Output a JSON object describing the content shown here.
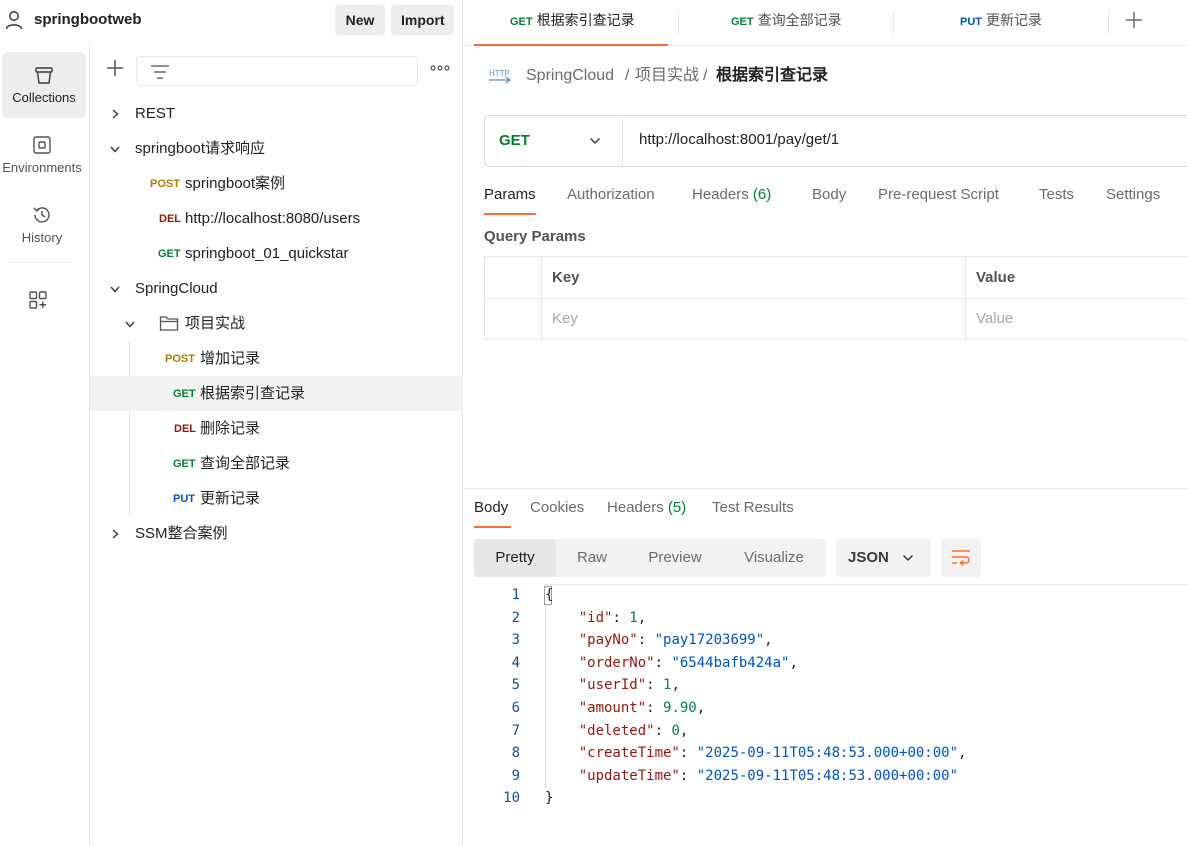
{
  "workspace": {
    "name": "springbootweb",
    "new_label": "New",
    "import_label": "Import"
  },
  "side_nav": {
    "collections": "Collections",
    "environments": "Environments",
    "history": "History"
  },
  "tree": [
    {
      "label": "REST"
    },
    {
      "label": "springboot请求响应"
    },
    {
      "method": "POST",
      "label": "springboot案例"
    },
    {
      "method": "DEL",
      "label": "http://localhost:8080/users"
    },
    {
      "method": "GET",
      "label": "springboot_01_quickstar"
    },
    {
      "label": "SpringCloud"
    },
    {
      "label": "项目实战"
    },
    {
      "method": "POST",
      "label": "增加记录"
    },
    {
      "method": "GET",
      "label": "根据索引查记录"
    },
    {
      "method": "DEL",
      "label": "删除记录"
    },
    {
      "method": "GET",
      "label": "查询全部记录"
    },
    {
      "method": "PUT",
      "label": "更新记录"
    },
    {
      "label": "SSM整合案例"
    }
  ],
  "tabs": [
    {
      "method": "GET",
      "label": "根据索引查记录"
    },
    {
      "method": "GET",
      "label": "查询全部记录"
    },
    {
      "method": "PUT",
      "label": "更新记录"
    }
  ],
  "breadcrumb": {
    "icon_text": "HTTP",
    "items": [
      "SpringCloud",
      "/",
      "项目实战",
      "/",
      "根据索引查记录"
    ]
  },
  "request": {
    "method": "GET",
    "url": "http://localhost:8001/pay/get/1"
  },
  "request_tabs": {
    "params": "Params",
    "authorization": "Authorization",
    "headers": "Headers",
    "headers_count": "(6)",
    "body": "Body",
    "pre_request": "Pre-request Script",
    "tests": "Tests",
    "settings": "Settings"
  },
  "query_params": {
    "title": "Query Params",
    "key_header": "Key",
    "value_header": "Value",
    "key_placeholder": "Key",
    "value_placeholder": "Value"
  },
  "response_tabs": {
    "body": "Body",
    "cookies": "Cookies",
    "headers": "Headers",
    "headers_count": "(5)",
    "test_results": "Test Results"
  },
  "format": {
    "pretty": "Pretty",
    "raw": "Raw",
    "preview": "Preview",
    "visualize": "Visualize",
    "language": "JSON"
  },
  "response_body": [
    {
      "n": "1",
      "parts": [
        [
          "p",
          "{"
        ]
      ]
    },
    {
      "n": "2",
      "parts": [
        [
          "p",
          "    "
        ],
        [
          "k",
          "\"id\""
        ],
        [
          "p",
          ": "
        ],
        [
          "v",
          "1"
        ],
        [
          "p",
          ","
        ]
      ]
    },
    {
      "n": "3",
      "parts": [
        [
          "p",
          "    "
        ],
        [
          "k",
          "\"payNo\""
        ],
        [
          "p",
          ": "
        ],
        [
          "s",
          "\"pay17203699\""
        ],
        [
          "p",
          ","
        ]
      ]
    },
    {
      "n": "4",
      "parts": [
        [
          "p",
          "    "
        ],
        [
          "k",
          "\"orderNo\""
        ],
        [
          "p",
          ": "
        ],
        [
          "s",
          "\"6544bafb424a\""
        ],
        [
          "p",
          ","
        ]
      ]
    },
    {
      "n": "5",
      "parts": [
        [
          "p",
          "    "
        ],
        [
          "k",
          "\"userId\""
        ],
        [
          "p",
          ": "
        ],
        [
          "v",
          "1"
        ],
        [
          "p",
          ","
        ]
      ]
    },
    {
      "n": "6",
      "parts": [
        [
          "p",
          "    "
        ],
        [
          "k",
          "\"amount\""
        ],
        [
          "p",
          ": "
        ],
        [
          "v",
          "9.90"
        ],
        [
          "p",
          ","
        ]
      ]
    },
    {
      "n": "7",
      "parts": [
        [
          "p",
          "    "
        ],
        [
          "k",
          "\"deleted\""
        ],
        [
          "p",
          ": "
        ],
        [
          "v",
          "0"
        ],
        [
          "p",
          ","
        ]
      ]
    },
    {
      "n": "8",
      "parts": [
        [
          "p",
          "    "
        ],
        [
          "k",
          "\"createTime\""
        ],
        [
          "p",
          ": "
        ],
        [
          "s",
          "\"2025-09-11T05:48:53.000+00:00\""
        ],
        [
          "p",
          ","
        ]
      ]
    },
    {
      "n": "9",
      "parts": [
        [
          "p",
          "    "
        ],
        [
          "k",
          "\"updateTime\""
        ],
        [
          "p",
          ": "
        ],
        [
          "s",
          "\"2025-09-11T05:48:53.000+00:00\""
        ]
      ]
    },
    {
      "n": "10",
      "parts": [
        [
          "p",
          "}"
        ]
      ]
    }
  ],
  "colors": {
    "accent": "#ff6c37",
    "get": "#007f31",
    "post": "#ad7a03",
    "del": "#8e1a10",
    "put": "#0053b8"
  }
}
